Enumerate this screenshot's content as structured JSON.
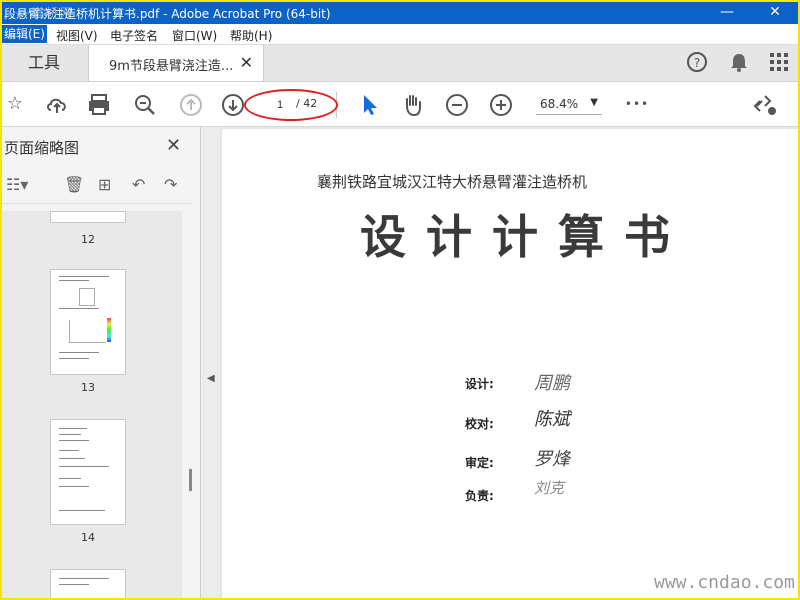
{
  "window": {
    "title": "段悬臂浇注造桥机计算书.pdf - Adobe Acrobat Pro (64-bit)",
    "watermark_top": "道桥网",
    "minimize": "—",
    "close": "✕"
  },
  "menubar": {
    "items": [
      "编辑(E)",
      "视图(V)",
      "电子签名",
      "窗口(W)",
      "帮助(H)"
    ]
  },
  "tabs": {
    "tools": "工具",
    "doc": "9m节段悬臂浇注造...",
    "close": "✕"
  },
  "top_icons": {
    "help": "?",
    "bell": "🔔",
    "apps": "⋮⋮"
  },
  "toolbar": {
    "page_current": "1",
    "page_total": "/ 42",
    "zoom": "68.4%",
    "more": "•••"
  },
  "sidebar": {
    "title": "页面缩略图",
    "close": "✕",
    "thumbs": [
      {
        "label": "12"
      },
      {
        "label": "13"
      },
      {
        "label": "14"
      }
    ]
  },
  "document": {
    "subtitle": "襄荆铁路宜城汉江特大桥悬臂灌注造桥机",
    "title": "设计计算书",
    "signatures": [
      {
        "label": "设计:",
        "sig": "周鹏"
      },
      {
        "label": "校对:",
        "sig": "陈斌"
      },
      {
        "label": "审定:",
        "sig": "罗烽"
      },
      {
        "label": "负责:",
        "sig": "刘克"
      }
    ]
  },
  "footer_watermark": "www.cndao.com",
  "colors": {
    "accent": "#0b63c8",
    "frame": "#f4e600",
    "highlight": "#e02020"
  }
}
